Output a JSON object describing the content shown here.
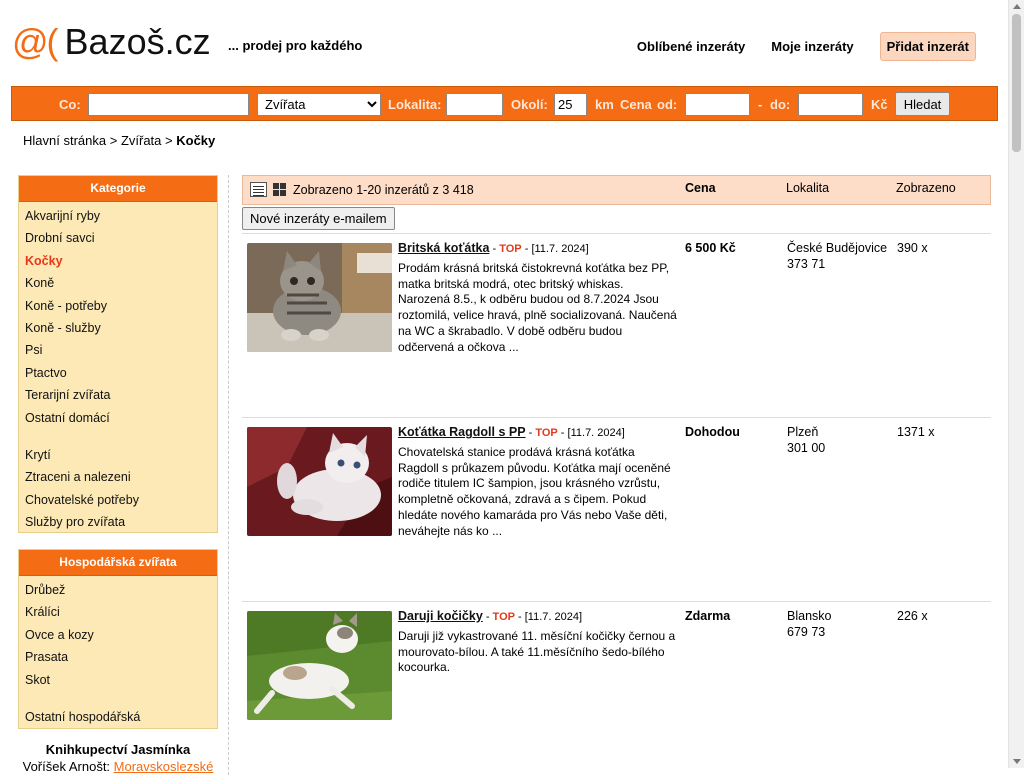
{
  "header": {
    "logo_mark": "@(",
    "logo_text": "Bazoš.cz",
    "tagline": "... prodej pro každého",
    "nav": [
      "Oblíbené inzeráty",
      "Moje inzeráty",
      "Přidat inzerát"
    ]
  },
  "search": {
    "labels": {
      "what": "Co:",
      "location": "Lokalita:",
      "radius": "Okolí:",
      "km": "km",
      "price": "Cena",
      "from": "od:",
      "dash": "-",
      "to": "do:",
      "currency": "Kč"
    },
    "what_value": "",
    "category_selected": "Zvířata",
    "location_value": "",
    "radius_value": "25",
    "price_from": "",
    "price_to": "",
    "submit_label": "Hledat"
  },
  "breadcrumb": {
    "home": "Hlavní stránka",
    "sep": ">",
    "section": "Zvířata",
    "current": "Kočky"
  },
  "sidebar": {
    "categories": {
      "title": "Kategorie",
      "items": [
        "Akvarijní ryby",
        "Drobní savci",
        "Kočky",
        "Koně",
        "Koně - potřeby",
        "Koně - služby",
        "Psi",
        "Ptactvo",
        "Terarijní zvířata",
        "Ostatní domácí",
        "Krytí",
        "Ztraceni a nalezeni",
        "Chovatelské potřeby",
        "Služby pro zvířata"
      ],
      "active": "Kočky"
    },
    "farm": {
      "title": "Hospodářská zvířata",
      "items": [
        "Drůbež",
        "Králíci",
        "Ovce a kozy",
        "Prasata",
        "Skot",
        "Ostatní hospodářská"
      ]
    },
    "promo": {
      "title": "Knihkupectví Jasmínka",
      "author": "Voříšek Arnošt:",
      "link": "Moravskoslezské"
    }
  },
  "listing": {
    "count_text": "Zobrazeno 1-20 inzerátů z 3 418",
    "columns": {
      "price": "Cena",
      "location": "Lokalita",
      "views": "Zobrazeno"
    },
    "email_button": "Nové inzeráty e-mailem",
    "items": [
      {
        "title": "Britská koťátka",
        "top": "TOP",
        "date": "[11.7. 2024]",
        "description": "Prodám krásná britská čistokrevná koťátka bez PP, matka britská modrá, otec britský whiskas. Narozená 8.5., k odběru budou od 8.7.2024 Jsou roztomilá, velice hravá, plně socializovaná. Naučená na WC a škrabadlo. V době odběru budou odčervená a očkova ...",
        "price": "6 500 Kč",
        "city": "České Budějovice",
        "zip": "373 71",
        "views": "390 x"
      },
      {
        "title": "Koťátka Ragdoll s PP",
        "top": "TOP",
        "date": "[11.7. 2024]",
        "description": "Chovatelská stanice prodává krásná koťátka Ragdoll s průkazem původu. Koťátka mají oceněné rodiče titulem IC šampion, jsou krásného vzrůstu, kompletně očkovaná, zdravá a s čipem. Pokud hledáte nového kamaráda pro Vás nebo Vaše děti, neváhejte nás ko ...",
        "price": "Dohodou",
        "city": "Plzeň",
        "zip": "301 00",
        "views": "1371 x"
      },
      {
        "title": "Daruji kočičky",
        "top": "TOP",
        "date": "[11.7. 2024]",
        "description": "Daruji již vykastrované 11. měsíční kočičky černou a mourovato-bílou. A také 11.měsíčního šedo-bílého kocourka.",
        "price": "Zdarma",
        "city": "Blansko",
        "zip": "679 73",
        "views": "226 x"
      }
    ]
  },
  "colors": {
    "brand": "#f46c13",
    "top_badge": "#e23a1a",
    "sidebar_bg": "#fde9b6",
    "listhead_bg": "#fdddc7"
  }
}
